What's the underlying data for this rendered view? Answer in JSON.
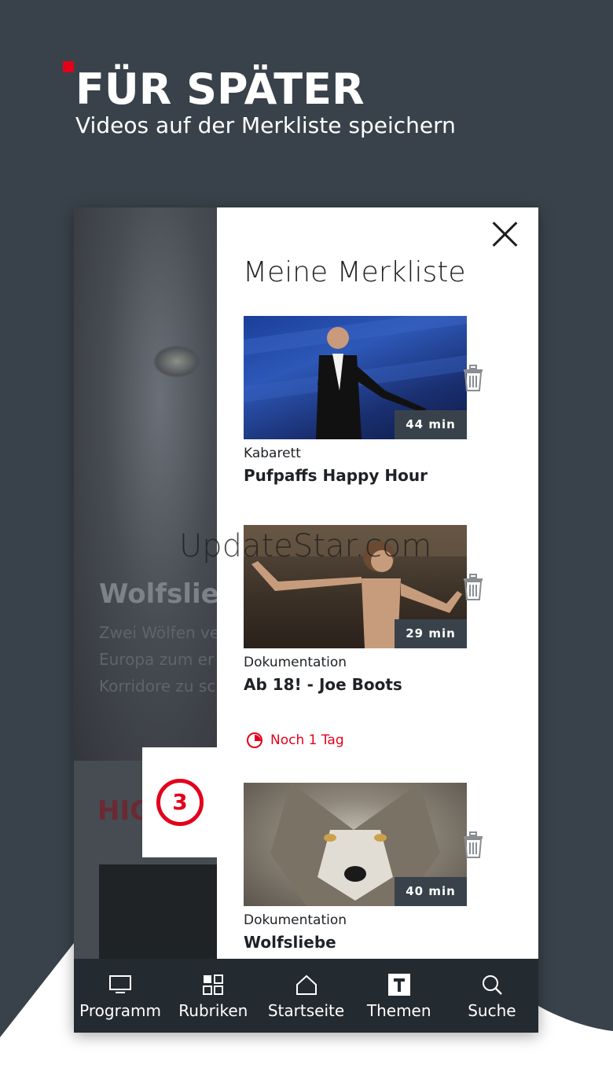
{
  "promo": {
    "headline": "FÜR SPÄTER",
    "subline": "Videos auf der Merkliste speichern"
  },
  "background_app": {
    "title": "Wolfsliebe",
    "description_lines": [
      "Zwei Wölfen ve",
      "Europa zum er",
      "Korridore zu sc"
    ],
    "section_label": "HIG",
    "channel_logo": "3"
  },
  "panel": {
    "title": "Meine Merkliste",
    "items": [
      {
        "category": "Kabarett",
        "title": "Pufpaffs Happy Hour",
        "duration": "44 min"
      },
      {
        "category": "Dokumentation",
        "title": "Ab 18! - Joe Boots",
        "duration": "29 min"
      },
      {
        "category": "Dokumentation",
        "title": "Wolfsliebe",
        "duration": "40 min"
      }
    ],
    "deadline": "Noch 1 Tag"
  },
  "nav": {
    "items": [
      {
        "label": "Programm",
        "icon": "tv-icon"
      },
      {
        "label": "Rubriken",
        "icon": "grid-icon"
      },
      {
        "label": "Startseite",
        "icon": "home-icon"
      },
      {
        "label": "Themen",
        "icon": "themen-icon"
      },
      {
        "label": "Suche",
        "icon": "search-icon"
      }
    ]
  },
  "watermark": "UpdateStar.com",
  "colors": {
    "accent": "#e3001b",
    "background": "#39424a",
    "nav": "#232a30"
  }
}
